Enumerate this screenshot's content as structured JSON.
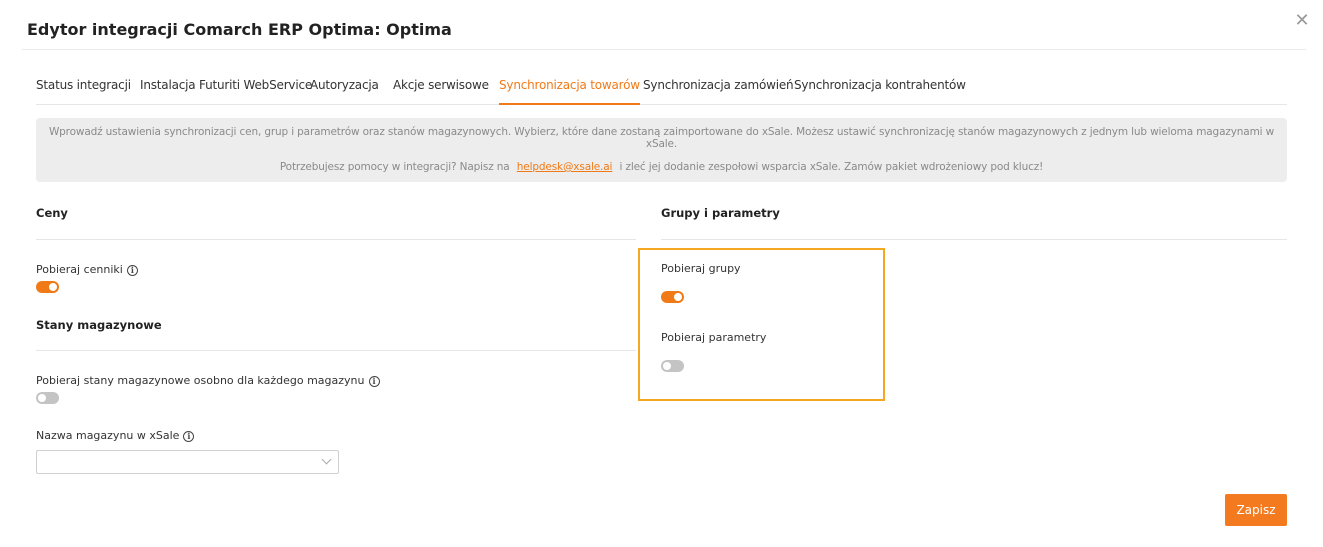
{
  "dialog": {
    "title": "Edytor integracji Comarch ERP Optima: Optima",
    "close_label": "✕"
  },
  "tabs": [
    {
      "label": "Status integracji",
      "active": false
    },
    {
      "label": "Instalacja Futuriti WebService",
      "active": false
    },
    {
      "label": "Autoryzacja",
      "active": false
    },
    {
      "label": "Akcje serwisowe",
      "active": false
    },
    {
      "label": "Synchronizacja towarów",
      "active": true
    },
    {
      "label": "Synchronizacja zamówień",
      "active": false
    },
    {
      "label": "Synchronizacja kontrahentów",
      "active": false
    }
  ],
  "info": {
    "line1": "Wprowadź ustawienia synchronizacji cen, grup i parametrów oraz stanów magazynowych. Wybierz, które dane zostaną zaimportowane do xSale. Możesz ustawić synchronizację stanów magazynowych z jednym lub wieloma magazynami w xSale.",
    "line2_before": "Potrzebujesz pomocy w integracji? Napisz na",
    "link": "helpdesk@xsale.ai",
    "line2_after": "i zleć jej dodanie zespołowi wsparcia xSale. Zamów pakiet wdrożeniowy pod klucz!"
  },
  "left": {
    "prices_title": "Ceny",
    "price_lists_label": "Pobieraj cenniki",
    "price_lists_on": true,
    "stock_title": "Stany magazynowe",
    "stock_per_warehouse_label": "Pobieraj stany magazynowe osobno dla każdego magazynu",
    "stock_per_warehouse_on": false,
    "warehouse_name_label": "Nazwa magazynu w xSale",
    "warehouse_select_value": ""
  },
  "right": {
    "groups_title": "Grupy i parametry",
    "groups_label": "Pobieraj grupy",
    "groups_on": true,
    "params_label": "Pobieraj parametry",
    "params_on": false
  },
  "icons": {
    "info": "info-icon",
    "close": "close-icon",
    "chevron": "chevron-down-icon"
  },
  "colors": {
    "accent": "#f07a18",
    "highlight": "#f5a623",
    "toggle_off": "#c4c4c4"
  },
  "footer": {
    "save_label": "Zapisz"
  }
}
